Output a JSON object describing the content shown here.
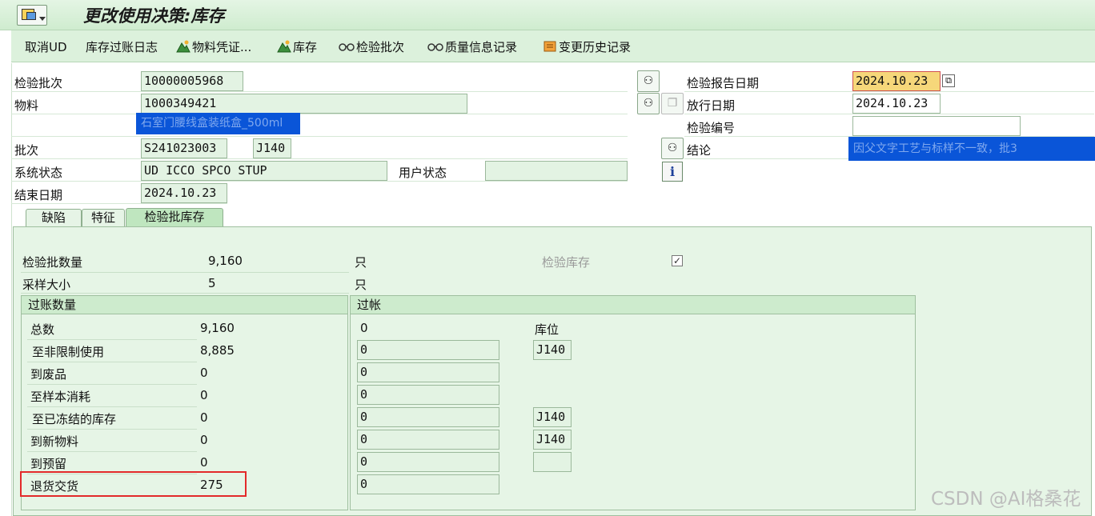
{
  "window": {
    "title": "更改使用决策:库存"
  },
  "toolbar": {
    "cancel_ud": "取消UD",
    "stock_posting_log": "库存过账日志",
    "material_document": "物料凭证...",
    "stock": "库存",
    "inspection_lot": "检验批次",
    "quality_notification": "质量信息记录",
    "change_history": "变更历史记录"
  },
  "header": {
    "inspection_lot_label": "检验批次",
    "inspection_lot_value": "10000005968",
    "material_label": "物料",
    "material_value": "1000349421",
    "material_desc": "石室门腰线盒装纸盒_500ml",
    "batch_label": "批次",
    "batch_value": "S241023003",
    "plant_value": "J140",
    "system_status_label": "系统状态",
    "system_status_value": "UD   ICCO SPCO STUP",
    "user_status_label": "用户状态",
    "user_status_value": "",
    "end_date_label": "结束日期",
    "end_date_value": "2024.10.23",
    "report_date_label": "检验报告日期",
    "report_date_value": "2024.10.23",
    "release_date_label": "放行日期",
    "release_date_value": "2024.10.23",
    "inspection_no_label": "检验编号",
    "inspection_no_value": "",
    "conclusion_label": "结论",
    "conclusion_value": "因父文字工艺与标样不一致，批3"
  },
  "tabs": [
    {
      "label": "缺陷"
    },
    {
      "label": "特征"
    },
    {
      "label": "检验批库存"
    }
  ],
  "lot_stock": {
    "lot_qty_label": "检验批数量",
    "lot_qty_value": "9,160",
    "sample_size_label": "采样大小",
    "sample_size_value": "5",
    "unit": "只",
    "inspection_stock_label": "检验库存",
    "inspection_stock_checked": "✓"
  },
  "posting_qty_group": {
    "title": "过账数量",
    "rows": [
      {
        "label": "总数",
        "value": "9,160"
      },
      {
        "label": "至非限制使用",
        "value": "8,885"
      },
      {
        "label": "到废品",
        "value": "0"
      },
      {
        "label": "至样本消耗",
        "value": "0"
      },
      {
        "label": "至已冻结的库存",
        "value": "0"
      },
      {
        "label": "到新物料",
        "value": "0"
      },
      {
        "label": "到预留",
        "value": "0"
      },
      {
        "label": "退货交货",
        "value": "275"
      }
    ]
  },
  "posted_group": {
    "title": "过帐",
    "storage_location_label": "库位",
    "total_value": "0",
    "rows": [
      {
        "value": "0",
        "sloc": "J140"
      },
      {
        "value": "0",
        "sloc": ""
      },
      {
        "value": "0",
        "sloc": ""
      },
      {
        "value": "0",
        "sloc": "J140"
      },
      {
        "value": "0",
        "sloc": "J140"
      },
      {
        "value": "0",
        "sloc": ""
      },
      {
        "value": "0",
        "sloc": ""
      }
    ]
  },
  "watermark": "CSDN @AI格桑花"
}
